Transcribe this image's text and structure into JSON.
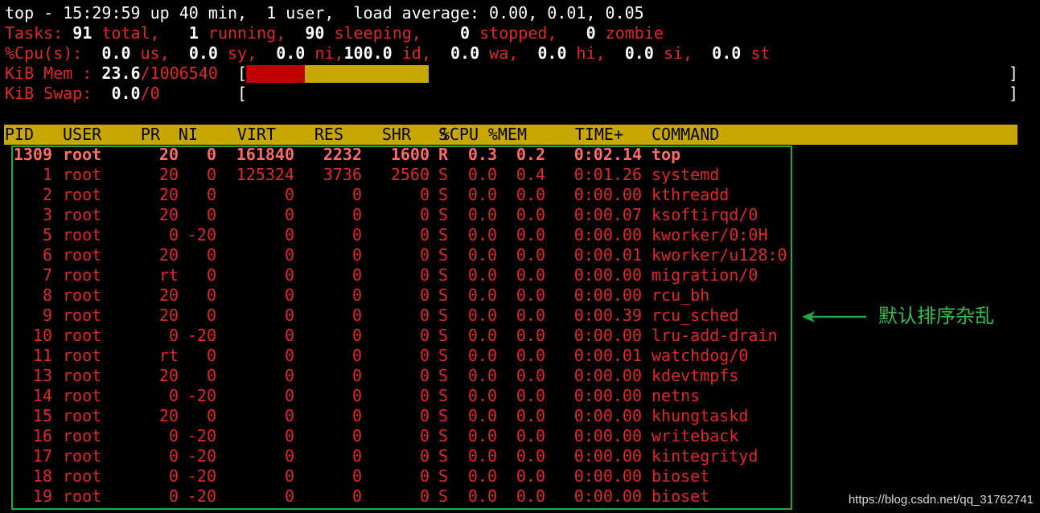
{
  "summary": {
    "line1": "top - 15:29:59 up 40 min,  1 user,  load average: 0.00, 0.01, 0.05",
    "tasks": {
      "label": "Tasks:",
      "total": "91",
      "total_label": "total,",
      "running": "1",
      "running_label": "running,",
      "sleeping": "90",
      "sleeping_label": "sleeping,",
      "stopped": "0",
      "stopped_label": "stopped,",
      "zombie": "0",
      "zombie_label": "zombie"
    },
    "cpu": {
      "label": "%Cpu(s):",
      "us": "0.0",
      "us_label": "us,",
      "sy": "0.0",
      "sy_label": "sy,",
      "ni": "0.0",
      "ni_label": "ni,",
      "id": "100.0",
      "id_label": "id,",
      "wa": "0.0",
      "wa_label": "wa,",
      "hi": "0.0",
      "hi_label": "hi,",
      "si": "0.0",
      "si_label": "si,",
      "st": "0.0",
      "st_label": "st"
    },
    "mem": {
      "label": "KiB Mem :",
      "used": "23.6",
      "total": "/1006540",
      "bar_red_fraction": 0.32,
      "bar_yellow_fraction": 0.68
    },
    "swap": {
      "label": "KiB Swap:",
      "used": "0.0",
      "total": "/0"
    },
    "bracket_open": "[",
    "bracket_close": "]"
  },
  "columns": [
    "PID",
    "USER",
    "PR",
    "NI",
    "VIRT",
    "RES",
    "SHR",
    "S",
    "%CPU",
    "%MEM",
    "TIME+",
    "COMMAND"
  ],
  "processes": [
    [
      "1309",
      "root",
      "20",
      "0",
      "161840",
      "2232",
      "1600",
      "R",
      "0.3",
      "0.2",
      "0:02.14",
      "top"
    ],
    [
      "1",
      "root",
      "20",
      "0",
      "125324",
      "3736",
      "2560",
      "S",
      "0.0",
      "0.4",
      "0:01.26",
      "systemd"
    ],
    [
      "2",
      "root",
      "20",
      "0",
      "0",
      "0",
      "0",
      "S",
      "0.0",
      "0.0",
      "0:00.00",
      "kthreadd"
    ],
    [
      "3",
      "root",
      "20",
      "0",
      "0",
      "0",
      "0",
      "S",
      "0.0",
      "0.0",
      "0:00.07",
      "ksoftirqd/0"
    ],
    [
      "5",
      "root",
      "0",
      "-20",
      "0",
      "0",
      "0",
      "S",
      "0.0",
      "0.0",
      "0:00.00",
      "kworker/0:0H"
    ],
    [
      "6",
      "root",
      "20",
      "0",
      "0",
      "0",
      "0",
      "S",
      "0.0",
      "0.0",
      "0:00.01",
      "kworker/u128:0"
    ],
    [
      "7",
      "root",
      "rt",
      "0",
      "0",
      "0",
      "0",
      "S",
      "0.0",
      "0.0",
      "0:00.00",
      "migration/0"
    ],
    [
      "8",
      "root",
      "20",
      "0",
      "0",
      "0",
      "0",
      "S",
      "0.0",
      "0.0",
      "0:00.00",
      "rcu_bh"
    ],
    [
      "9",
      "root",
      "20",
      "0",
      "0",
      "0",
      "0",
      "S",
      "0.0",
      "0.0",
      "0:00.39",
      "rcu_sched"
    ],
    [
      "10",
      "root",
      "0",
      "-20",
      "0",
      "0",
      "0",
      "S",
      "0.0",
      "0.0",
      "0:00.00",
      "lru-add-drain"
    ],
    [
      "11",
      "root",
      "rt",
      "0",
      "0",
      "0",
      "0",
      "S",
      "0.0",
      "0.0",
      "0:00.01",
      "watchdog/0"
    ],
    [
      "13",
      "root",
      "20",
      "0",
      "0",
      "0",
      "0",
      "S",
      "0.0",
      "0.0",
      "0:00.00",
      "kdevtmpfs"
    ],
    [
      "14",
      "root",
      "0",
      "-20",
      "0",
      "0",
      "0",
      "S",
      "0.0",
      "0.0",
      "0:00.00",
      "netns"
    ],
    [
      "15",
      "root",
      "20",
      "0",
      "0",
      "0",
      "0",
      "S",
      "0.0",
      "0.0",
      "0:00.00",
      "khungtaskd"
    ],
    [
      "16",
      "root",
      "0",
      "-20",
      "0",
      "0",
      "0",
      "S",
      "0.0",
      "0.0",
      "0:00.00",
      "writeback"
    ],
    [
      "17",
      "root",
      "0",
      "-20",
      "0",
      "0",
      "0",
      "S",
      "0.0",
      "0.0",
      "0:00.00",
      "kintegrityd"
    ],
    [
      "18",
      "root",
      "0",
      "-20",
      "0",
      "0",
      "0",
      "S",
      "0.0",
      "0.0",
      "0:00.00",
      "bioset"
    ],
    [
      "19",
      "root",
      "0",
      "-20",
      "0",
      "0",
      "0",
      "S",
      "0.0",
      "0.0",
      "0:00.00",
      "bioset"
    ]
  ],
  "annotation": "默认排序杂乱",
  "watermark": "https://blog.csdn.net/qq_31762741",
  "colors": {
    "background": "#000000",
    "label_red": "#e3262b",
    "value_white": "#ffffff",
    "header_yellow": "#c8a800",
    "mem_bar_red": "#c00000",
    "highlight_box_green": "#1fa84a",
    "annotation_green": "#2fbf4a"
  },
  "icons": [
    "arrow-left-icon"
  ]
}
